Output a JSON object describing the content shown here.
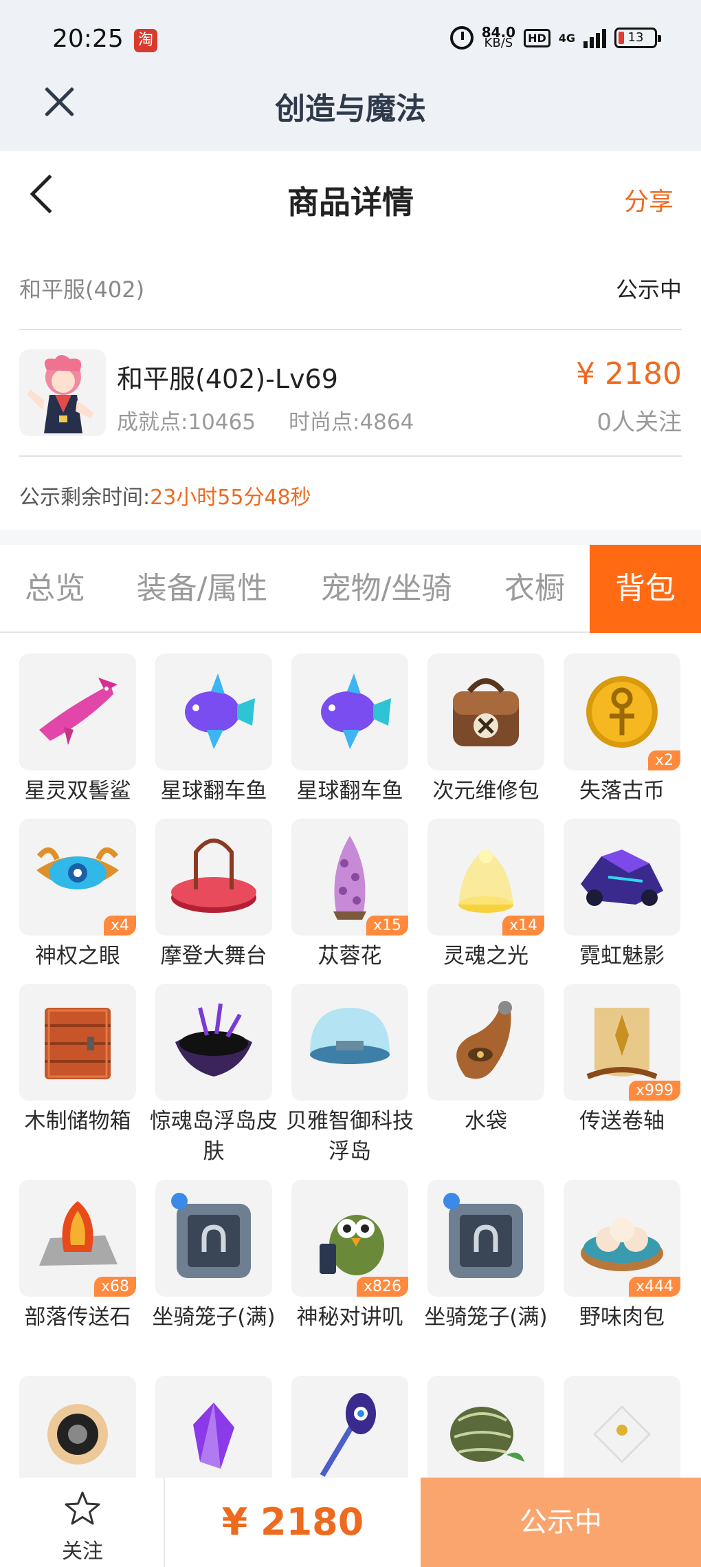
{
  "status_bar": {
    "time": "20:25",
    "taobao_icon_text": "淘",
    "net_speed": "84.0",
    "net_unit": "KB/S",
    "hd": "HD",
    "network": "4G",
    "battery": "13"
  },
  "app_header": {
    "title": "创造与魔法"
  },
  "page_header": {
    "title": "商品详情",
    "share": "分享"
  },
  "listing": {
    "server": "和平服(402)",
    "status": "公示中",
    "name": "和平服(402)-Lv69",
    "achievement": "成就点:10465",
    "fashion": "时尚点:4864",
    "price": "¥ 2180",
    "follows": "0人关注",
    "timer_label": "公示剩余时间:",
    "timer_value": "23小时55分48秒"
  },
  "tabs": [
    "总览",
    "装备/属性",
    "宠物/坐骑",
    "衣橱",
    "背包"
  ],
  "active_tab": "背包",
  "items": [
    {
      "name": "星灵双髻鲨",
      "count": "",
      "icon": "hammerhead-shark-icon"
    },
    {
      "name": "星球翻车鱼",
      "count": "",
      "icon": "sunfish-icon"
    },
    {
      "name": "星球翻车鱼",
      "count": "",
      "icon": "sunfish-icon"
    },
    {
      "name": "次元维修包",
      "count": "",
      "icon": "repair-bag-icon"
    },
    {
      "name": "失落古币",
      "count": "x2",
      "icon": "gold-coin-icon"
    },
    {
      "name": "神权之眼",
      "count": "x4",
      "icon": "divine-eye-icon"
    },
    {
      "name": "摩登大舞台",
      "count": "",
      "icon": "stage-icon"
    },
    {
      "name": "苁蓉花",
      "count": "x15",
      "icon": "cistanche-flower-icon"
    },
    {
      "name": "灵魂之光",
      "count": "x14",
      "icon": "soul-light-icon"
    },
    {
      "name": "霓虹魅影",
      "count": "",
      "icon": "neon-vehicle-icon"
    },
    {
      "name": "木制储物箱",
      "count": "",
      "icon": "wooden-chest-icon"
    },
    {
      "name": "惊魂岛浮岛皮肤",
      "count": "",
      "icon": "dark-island-icon"
    },
    {
      "name": "贝雅智御科技浮岛",
      "count": "",
      "icon": "dome-island-icon"
    },
    {
      "name": "水袋",
      "count": "",
      "icon": "water-bag-icon"
    },
    {
      "name": "传送卷轴",
      "count": "x999",
      "icon": "scroll-icon"
    },
    {
      "name": "部落传送石",
      "count": "x68",
      "icon": "teleport-stone-icon"
    },
    {
      "name": "坐骑笼子(满)",
      "count": "",
      "icon": "mount-cage-icon"
    },
    {
      "name": "神秘对讲叽",
      "count": "x826",
      "icon": "walkie-talkie-bird-icon"
    },
    {
      "name": "坐骑笼子(满)",
      "count": "",
      "icon": "mount-cage-icon"
    },
    {
      "name": "野味肉包",
      "count": "x444",
      "icon": "meat-bun-icon"
    },
    {
      "name": "",
      "count": "",
      "icon": "dark-sun-icon"
    },
    {
      "name": "",
      "count": "",
      "icon": "purple-crystal-icon"
    },
    {
      "name": "",
      "count": "",
      "icon": "eye-staff-icon"
    },
    {
      "name": "",
      "count": "",
      "icon": "melon-icon"
    },
    {
      "name": "",
      "count": "",
      "icon": "white-gem-icon"
    }
  ],
  "bottom_bar": {
    "follow_label": "关注",
    "price": "¥ 2180",
    "status": "公示中"
  },
  "colors": {
    "accent": "#ff6a13",
    "price": "#ee6a1e",
    "header_bg": "#eef2f6"
  }
}
